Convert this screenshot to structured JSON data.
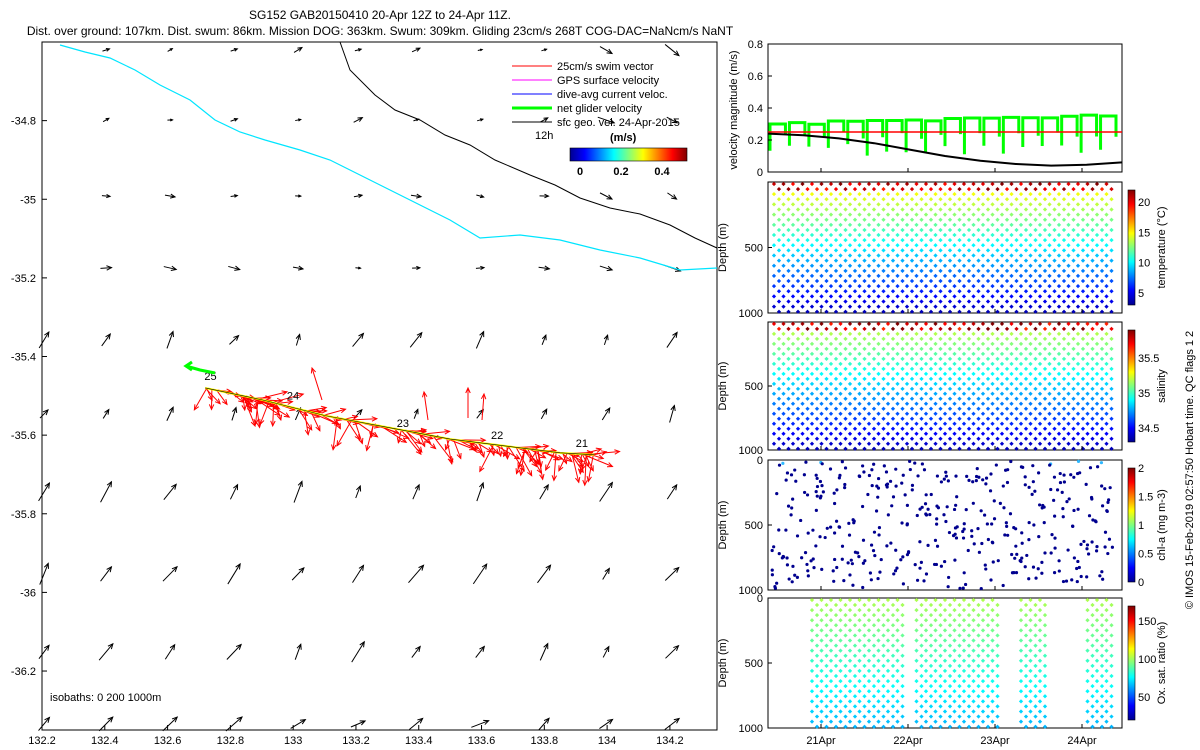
{
  "header": {
    "title_line1": "SG152 GAB20150410 20-Apr 12Z to 24-Apr 11Z.",
    "title_line2": "Dist. over ground: 107km. Dist. swum: 86km. Mission DOG: 363km. Swum: 309km. Gliding 23cm/s 268T COG-DAC=NaNcm/s NaNT"
  },
  "colors": {
    "swim_vector": "#ff0000",
    "gps_surface": "#ff00ff",
    "dive_avg": "#0000ff",
    "net_glider": "#00ff00",
    "sfc_geo": "#000000",
    "isobath_1000": "#00e5ff",
    "isobath_200": "#000000",
    "track_line": "#ffff00",
    "velocity_ref": "#ff0000",
    "velocity_fill": "#00ff00",
    "velocity_dac": "#000000"
  },
  "map": {
    "legend": {
      "items": [
        "25cm/s swim vector",
        "GPS surface velocity",
        "dive-avg current veloc.",
        "net glider velocity",
        "sfc geo. vel. 24-Apr-2015"
      ],
      "time_note": "12h",
      "colorbar_unit": "(m/s)",
      "colorbar_ticks": [
        "0",
        "0.2",
        "0.4"
      ]
    },
    "x_ticks": [
      "132.2",
      "132.4",
      "132.6",
      "132.8",
      "133",
      "133.2",
      "133.4",
      "133.6",
      "133.8",
      "134",
      "134.2"
    ],
    "y_ticks": [
      "-34.8",
      "-35",
      "-35.2",
      "-35.4",
      "-35.6",
      "-35.8",
      "-36",
      "-36.2"
    ],
    "isobath_note": "isobaths: 0   200  1000m",
    "day_labels": [
      "25",
      "24",
      "23",
      "22",
      "21"
    ]
  },
  "panels": {
    "velocity": {
      "ylabel": "velocity magnitude (m/s)",
      "y_ticks": [
        "0",
        "0.2",
        "0.4",
        "0.6",
        "0.8"
      ]
    },
    "temperature": {
      "ylabel": "Depth (m)",
      "y_ticks": [
        "500",
        "1000"
      ],
      "cbar_label": "temperature (°C)",
      "cbar_ticks": [
        "5",
        "10",
        "15",
        "20"
      ]
    },
    "salinity": {
      "ylabel": "Depth (m)",
      "y_ticks": [
        "500",
        "1000"
      ],
      "cbar_label": "salinity",
      "cbar_ticks": [
        "34.5",
        "35",
        "35.5"
      ]
    },
    "chla": {
      "ylabel": "Depth (m)",
      "y_ticks": [
        "0",
        "500",
        "1000"
      ],
      "cbar_label": "chl-a (mg m-3)",
      "cbar_ticks": [
        "0",
        "0.5",
        "1",
        "1.5",
        "2"
      ]
    },
    "oxygen": {
      "ylabel": "Depth (m)",
      "y_ticks": [
        "0",
        "500",
        "1000"
      ],
      "cbar_label": "Ox. sat. ratio (%)",
      "cbar_ticks": [
        "50",
        "100",
        "150"
      ]
    },
    "x_ticks": [
      "21Apr",
      "22Apr",
      "23Apr",
      "24Apr"
    ]
  },
  "credit": "© IMOS 15-Feb-2019 02:57:50 Hobart time. QC flags 1  2",
  "chart_data": [
    {
      "type": "line",
      "name": "glider track map",
      "x_range": [
        132.2,
        134.35
      ],
      "y_range": [
        -36.35,
        -34.6
      ],
      "track": {
        "lon": [
          132.72,
          132.9,
          133.1,
          133.3,
          133.5,
          133.7,
          133.85,
          133.96
        ],
        "lat": [
          -35.48,
          -35.51,
          -35.55,
          -35.58,
          -35.61,
          -35.63,
          -35.645,
          -35.65
        ]
      },
      "day_markers": [
        {
          "label": "25",
          "lon": 132.73,
          "lat": -35.47
        },
        {
          "label": "24",
          "lon": 132.98,
          "lat": -35.52
        },
        {
          "label": "23",
          "lon": 133.33,
          "lat": -35.59
        },
        {
          "label": "22",
          "lon": 133.63,
          "lat": -35.62
        },
        {
          "label": "21",
          "lon": 133.9,
          "lat": -35.64
        }
      ]
    },
    {
      "type": "line",
      "name": "velocity magnitude",
      "x_range": [
        "20-Apr 12Z",
        "24-Apr 11Z"
      ],
      "ylim": [
        0,
        0.8
      ],
      "reference_speed": 0.25,
      "dac_x_fraction": [
        0.0,
        0.1,
        0.2,
        0.3,
        0.4,
        0.5,
        0.6,
        0.7,
        0.8,
        0.9,
        1.0
      ],
      "dac_values": [
        0.24,
        0.23,
        0.21,
        0.18,
        0.14,
        0.1,
        0.07,
        0.05,
        0.04,
        0.045,
        0.06
      ]
    },
    {
      "type": "scatter",
      "name": "temperature section",
      "ylim": [
        1000,
        0
      ],
      "clim": [
        3,
        22
      ]
    },
    {
      "type": "scatter",
      "name": "salinity section",
      "ylim": [
        1000,
        0
      ],
      "clim": [
        34.3,
        35.9
      ]
    },
    {
      "type": "scatter",
      "name": "chl-a section",
      "ylim": [
        1000,
        0
      ],
      "clim": [
        0,
        2
      ]
    },
    {
      "type": "scatter",
      "name": "oxygen section",
      "ylim": [
        1000,
        0
      ],
      "clim": [
        20,
        170
      ]
    }
  ]
}
